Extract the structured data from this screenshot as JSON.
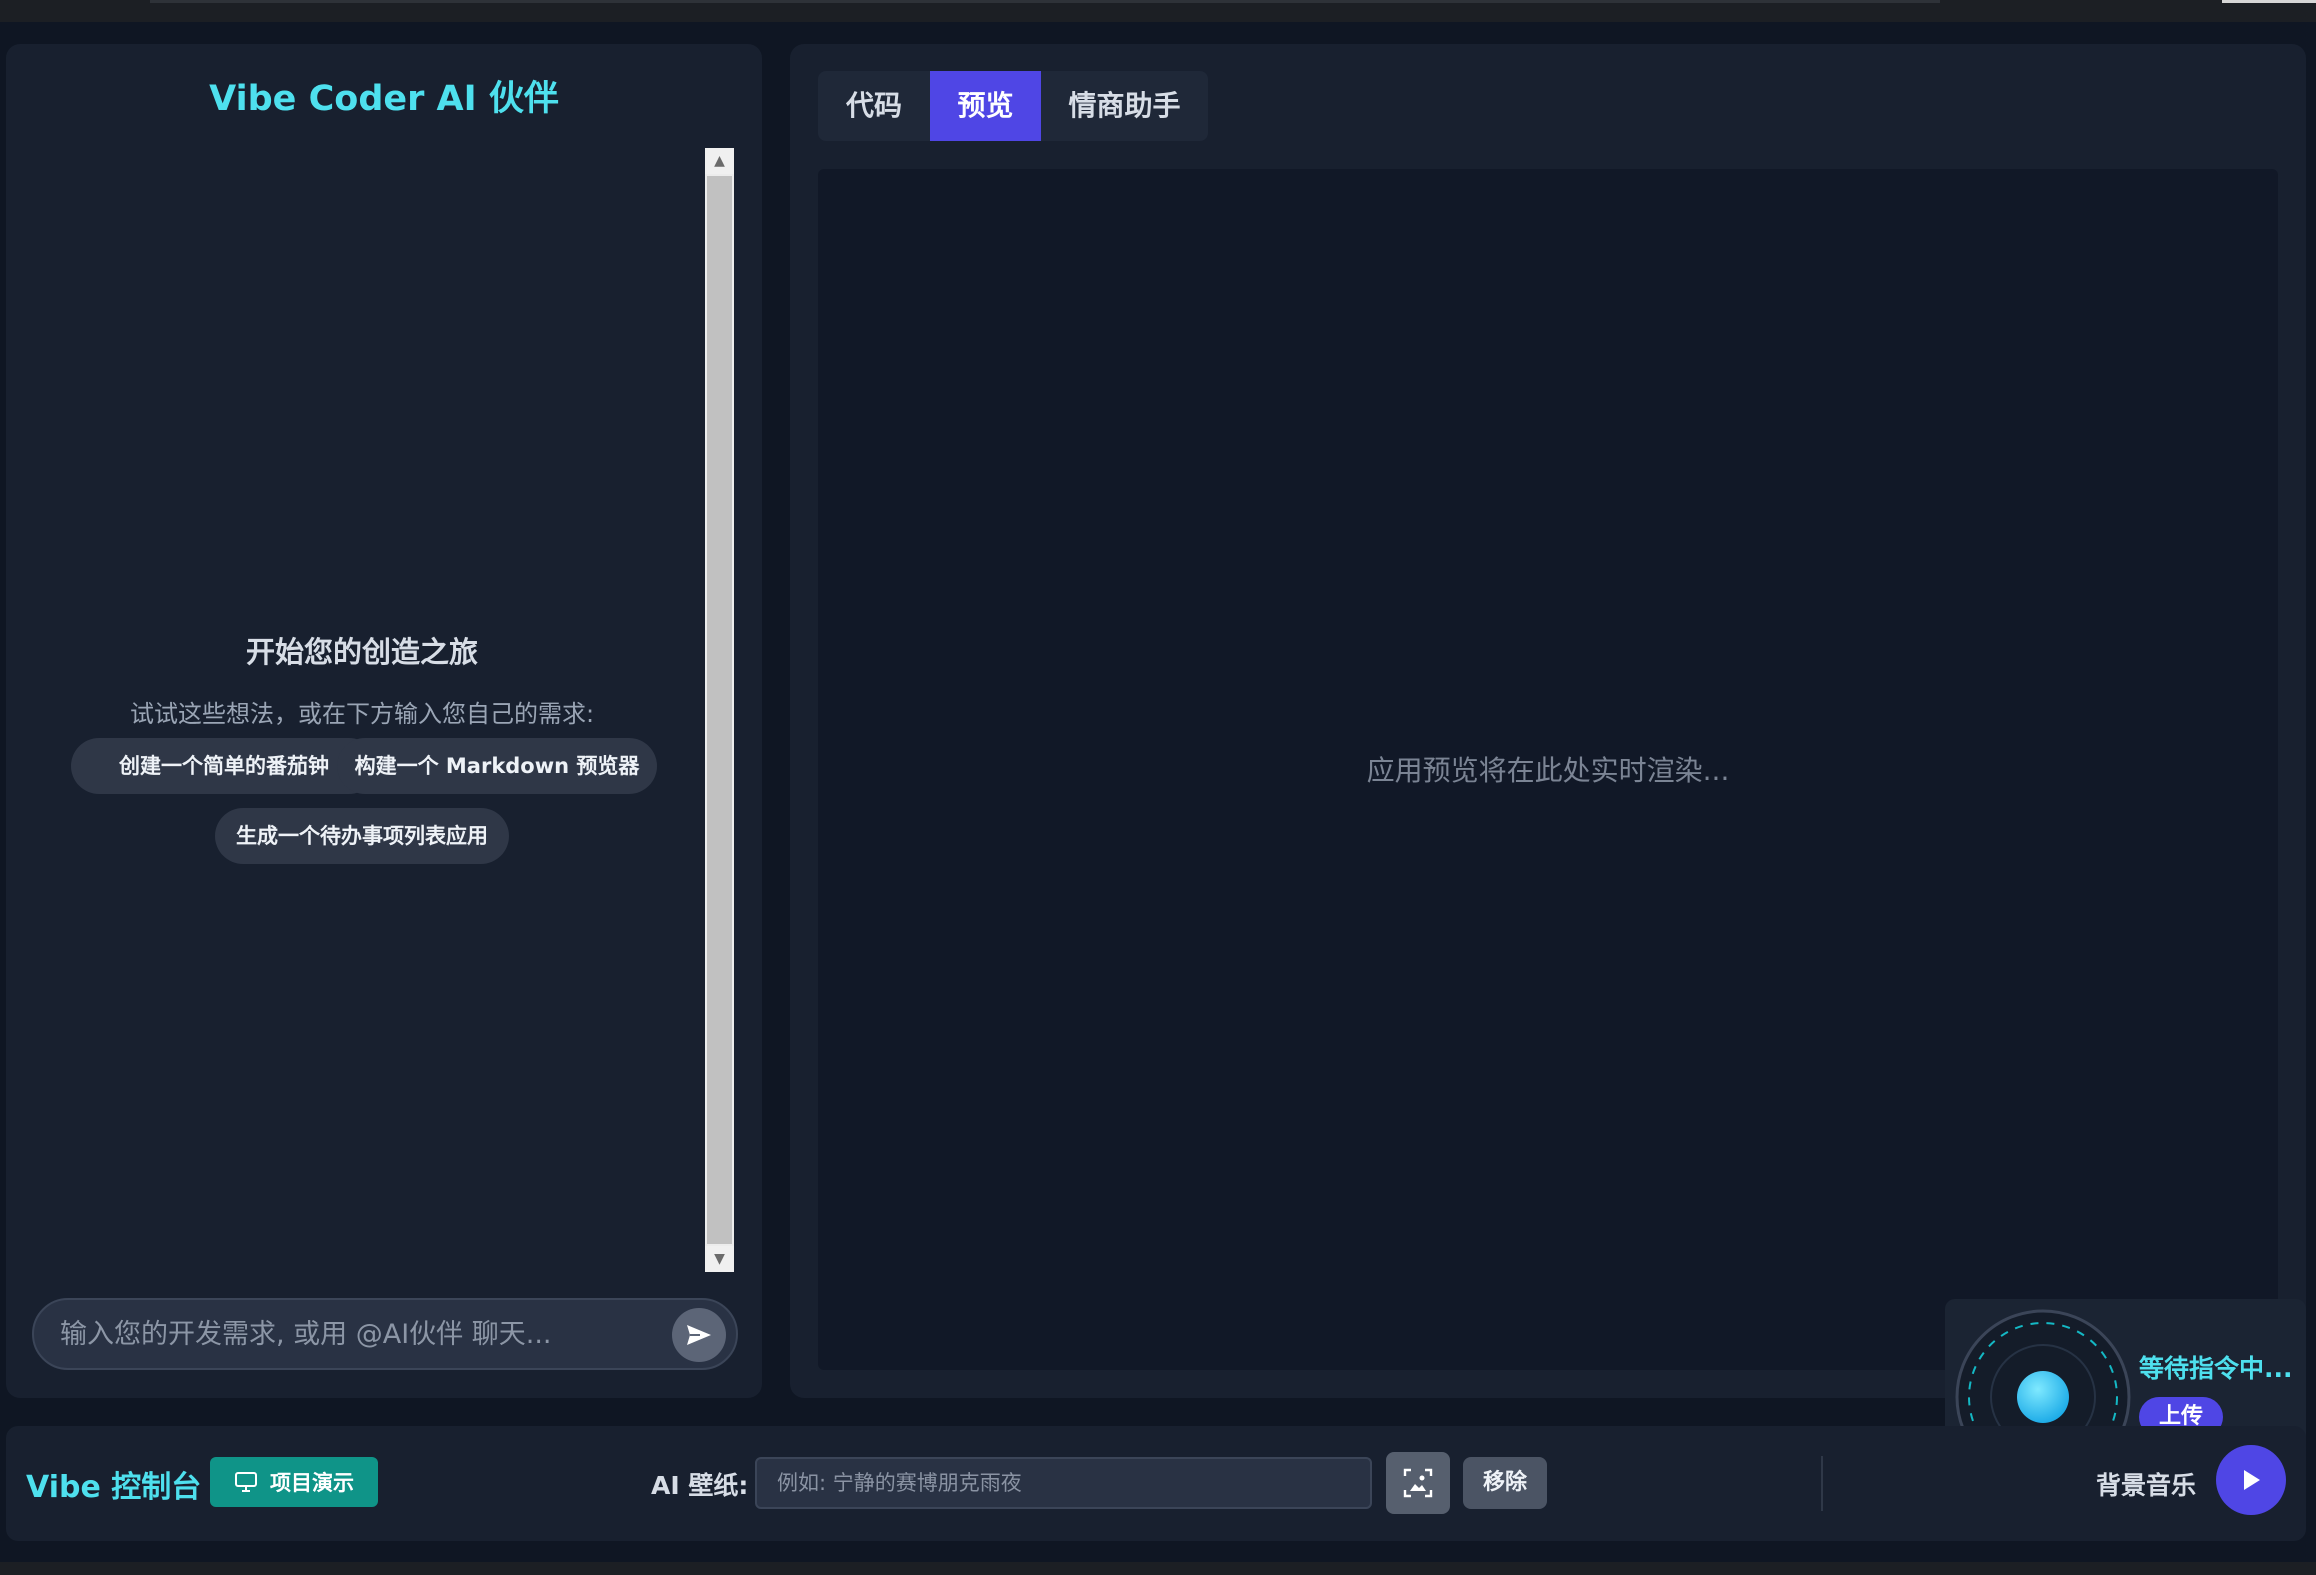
{
  "left_panel": {
    "title": "Vibe Coder AI 伙伴",
    "welcome_title": "开始您的创造之旅",
    "welcome_subtitle": "试试这些想法，或在下方输入您自己的需求:",
    "suggestions": [
      "创建一个简单的番茄钟",
      "构建一个 Markdown 预览器",
      "生成一个待办事项列表应用"
    ],
    "chat_input": {
      "placeholder": "输入您的开发需求, 或用 @AI伙伴 聊天...",
      "value": ""
    }
  },
  "right_panel": {
    "tabs": [
      {
        "label": "代码",
        "active": false
      },
      {
        "label": "预览",
        "active": true
      },
      {
        "label": "情商助手",
        "active": false
      }
    ],
    "preview_placeholder": "应用预览将在此处实时渲染...",
    "voice_widget": {
      "status": "等待指令中...",
      "upload_label": "上传"
    }
  },
  "bottom_bar": {
    "console_title": "Vibe 控制台",
    "demo_button": "项目演示",
    "wallpaper_label": "AI 壁纸:",
    "wallpaper_input": {
      "placeholder": "例如: 宁静的赛博朋克雨夜",
      "value": ""
    },
    "remove_button": "移除",
    "music_label": "背景音乐"
  },
  "colors": {
    "accent_cyan": "#4ee0ee",
    "accent_indigo": "#4f46e5",
    "teal_button": "#0f9488",
    "panel_bg": "#18202f",
    "page_bg": "#0f1623"
  },
  "icons": {
    "send": "send-icon",
    "monitor": "monitor-icon",
    "image_generate": "image-generate-icon",
    "play": "play-icon",
    "scroll_up": "chevron-up-icon",
    "scroll_down": "chevron-down-icon"
  }
}
